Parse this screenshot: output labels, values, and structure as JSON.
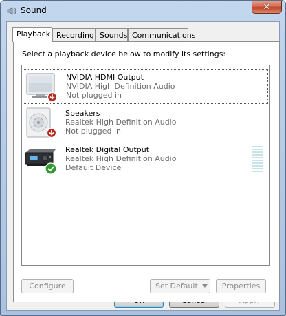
{
  "window": {
    "title": "Sound",
    "close_glyph": "✕"
  },
  "tabs": [
    {
      "label": "Playback",
      "active": true
    },
    {
      "label": "Recording",
      "active": false
    },
    {
      "label": "Sounds",
      "active": false
    },
    {
      "label": "Communications",
      "active": false
    }
  ],
  "playback": {
    "instruction": "Select a playback device below to modify its settings:",
    "devices": [
      {
        "name": "NVIDIA HDMI Output",
        "driver": "NVIDIA High Definition Audio",
        "status": "Not plugged in",
        "icon": "hdmi-monitor-icon",
        "badge": "red-down-arrow",
        "selected": true
      },
      {
        "name": "Speakers",
        "driver": "Realtek High Definition Audio",
        "status": "Not plugged in",
        "icon": "speaker-icon",
        "badge": "red-down-arrow",
        "selected": false
      },
      {
        "name": "Realtek Digital Output",
        "driver": "Realtek High Definition Audio",
        "status": "Default Device",
        "icon": "digital-receiver-icon",
        "badge": "green-check",
        "selected": false,
        "level": 0
      }
    ],
    "configure_label": "Configure",
    "set_default_label": "Set Default",
    "properties_label": "Properties"
  },
  "footer": {
    "ok_label": "OK",
    "cancel_label": "Cancel",
    "apply_label": "Apply"
  },
  "colors": {
    "accent_green": "#3aa63a",
    "badge_red": "#c0392b",
    "meter": "#c8e2ea"
  }
}
